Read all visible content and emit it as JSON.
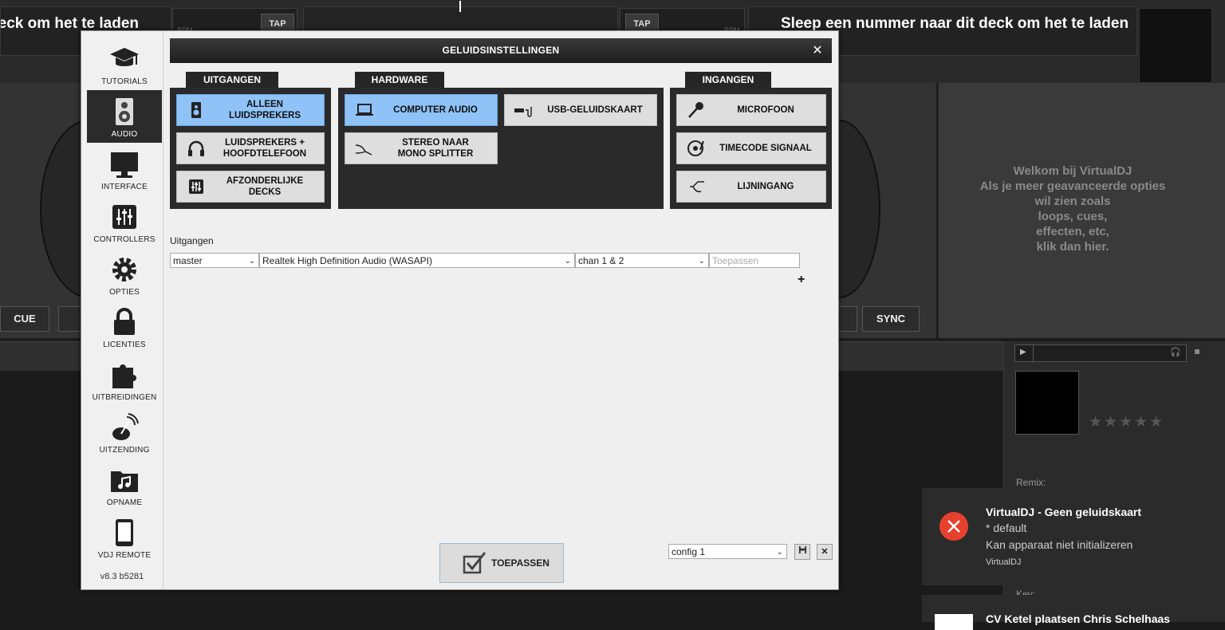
{
  "background": {
    "left_deck_title": "Sleep een nummer naar dit deck om het te laden",
    "right_deck_title": "Sleep een nummer naar dit deck om het te laden",
    "bpm_label": "BPM",
    "tap_label": "TAP",
    "cue_label": "CUE",
    "sync_label": "SYNC",
    "welcome_text": "Welkom bij VirtualDJ\nAls je meer geavanceerde opties\nwil zien zoals\nloops, cues,\neffecten, etc,\nklik dan hier.",
    "remix_label": "Remix:",
    "key_label": "Key:"
  },
  "sidebar": {
    "items": [
      {
        "label": "TUTORIALS",
        "icon": "graduation-cap-icon"
      },
      {
        "label": "AUDIO",
        "icon": "speaker-icon"
      },
      {
        "label": "INTERFACE",
        "icon": "monitor-icon"
      },
      {
        "label": "CONTROLLERS",
        "icon": "sliders-icon"
      },
      {
        "label": "OPTIES",
        "icon": "gear-icon"
      },
      {
        "label": "LICENTIES",
        "icon": "lock-icon"
      },
      {
        "label": "UITBREIDINGEN",
        "icon": "puzzle-icon"
      },
      {
        "label": "UITZENDING",
        "icon": "broadcast-icon"
      },
      {
        "label": "OPNAME",
        "icon": "music-folder-icon"
      },
      {
        "label": "VDJ REMOTE",
        "icon": "tablet-icon"
      }
    ],
    "active_index": 1,
    "version": "v8.3 b5281"
  },
  "dialog": {
    "title": "GELUIDSINSTELLINGEN",
    "close": "✕",
    "tabs": {
      "outputs": "UITGANGEN",
      "hardware": "HARDWARE",
      "inputs": "INGANGEN"
    },
    "outputs": [
      {
        "label": "ALLEEN\nLUIDSPREKERS",
        "selected": true
      },
      {
        "label": "LUIDSPREKERS +\nHOOFDTELEFOON",
        "selected": false
      },
      {
        "label": "AFZONDERLIJKE\nDECKS",
        "selected": false
      }
    ],
    "hardware": [
      {
        "label": "COMPUTER AUDIO",
        "selected": true
      },
      {
        "label": "USB-GELUIDSKAART",
        "selected": false
      },
      {
        "label": "STEREO NAAR\nMONO SPLITTER",
        "selected": false
      }
    ],
    "inputs": [
      {
        "label": "MICROFOON"
      },
      {
        "label": "TIMECODE SIGNAAL"
      },
      {
        "label": "LIJNINGANG"
      }
    ],
    "outputs_section_label": "Uitgangen",
    "row": {
      "channel": "master",
      "device": "Realtek High Definition Audio (WASAPI)",
      "chan": "chan 1 & 2",
      "apply_placeholder": "Toepassen"
    },
    "add": "+",
    "apply_button": "TOEPASSEN",
    "config_select": "config 1",
    "delete": "✕"
  },
  "notification": {
    "title": "VirtualDJ - Geen geluidskaart",
    "line1": "* default",
    "line2": "Kan apparaat niet initializeren",
    "app": "VirtualDJ",
    "next_title": "CV Ketel plaatsen Chris Schelhaas"
  }
}
